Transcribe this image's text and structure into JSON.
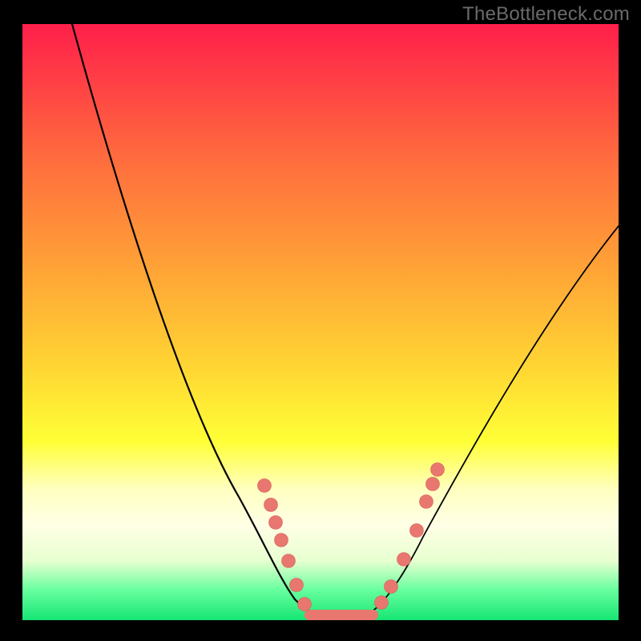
{
  "watermark": "TheBottleneck.com",
  "chart_data": {
    "type": "line",
    "title": "",
    "xlabel": "",
    "ylabel": "",
    "xlim": [
      0,
      100
    ],
    "ylim": [
      0,
      100
    ],
    "grid": false,
    "background_gradient": {
      "direction": "vertical",
      "stops": [
        {
          "pos": 0.0,
          "color": "#ff1f4b"
        },
        {
          "pos": 0.22,
          "color": "#ff6a3e"
        },
        {
          "pos": 0.58,
          "color": "#ffd733"
        },
        {
          "pos": 0.78,
          "color": "#ffffc0"
        },
        {
          "pos": 0.95,
          "color": "#66ff9e"
        },
        {
          "pos": 1.0,
          "color": "#16e574"
        }
      ]
    },
    "series": [
      {
        "name": "left-curve",
        "x": [
          8,
          15,
          22,
          30,
          36,
          42,
          46,
          49
        ],
        "y": [
          100,
          77,
          55,
          35,
          22,
          10,
          3,
          1
        ]
      },
      {
        "name": "right-curve",
        "x": [
          58,
          62,
          67,
          75,
          85,
          100
        ],
        "y": [
          1,
          4,
          14,
          30,
          50,
          66
        ]
      }
    ],
    "valley_flat": {
      "x_start": 47,
      "x_end": 60,
      "y": 1
    },
    "marker_points": {
      "left": [
        {
          "x": 41,
          "y": 23
        },
        {
          "x": 42,
          "y": 19
        },
        {
          "x": 43,
          "y": 16
        },
        {
          "x": 43.5,
          "y": 13
        },
        {
          "x": 45,
          "y": 10
        },
        {
          "x": 46,
          "y": 6
        },
        {
          "x": 47,
          "y": 3
        }
      ],
      "right": [
        {
          "x": 60,
          "y": 3
        },
        {
          "x": 62,
          "y": 6
        },
        {
          "x": 64,
          "y": 10
        },
        {
          "x": 66,
          "y": 15
        },
        {
          "x": 68,
          "y": 20
        },
        {
          "x": 69,
          "y": 23
        },
        {
          "x": 70,
          "y": 25
        }
      ]
    },
    "marker_color": "#e8776f"
  }
}
